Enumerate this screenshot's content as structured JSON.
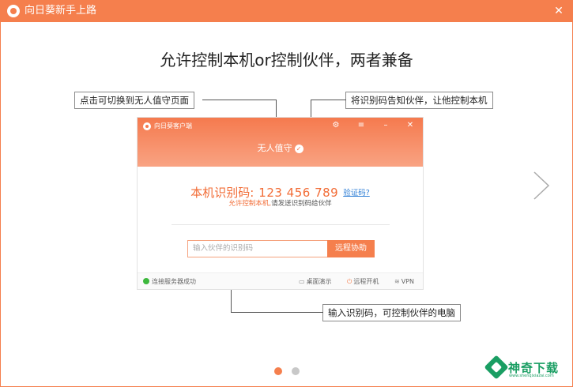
{
  "window": {
    "title": "向日葵新手上路",
    "close_icon": "close-icon",
    "accent_color": "#f57f4d"
  },
  "heading": "允许控制本机or控制伙伴，两者兼备",
  "callouts": {
    "top_left": "点击可切换到无人值守页面",
    "top_right": "将识别码告知伙伴，让他控制本机",
    "bottom": "输入识别码，可控制伙伴的电脑"
  },
  "client": {
    "title": "向日葵客户端",
    "header_controls": [
      "settings-icon",
      "menu-icon",
      "minimize-icon",
      "close-icon"
    ],
    "unattended_label": "无人值守",
    "id_label": "本机识别码:",
    "id_value": "123 456 789",
    "verify_link": "验证码?",
    "hint_orange": "允许控制本机,",
    "hint_rest": "请发送识别码给伙伴",
    "partner_input_placeholder": "输入伙伴的识别码",
    "remote_assist_button": "远程协助",
    "footer": {
      "status": "连接服务器成功",
      "status_color": "#3db83d",
      "desktop_demo": "桌面演示",
      "remote_boot": "远程开机",
      "vpn": "VPN"
    }
  },
  "pagination": {
    "current": 1,
    "total": 2,
    "active_color": "#f57f4d",
    "inactive_color": "#c8c8c8"
  },
  "watermark": {
    "text": "神奇下载",
    "sub": "www.shenqixiazai.com"
  }
}
